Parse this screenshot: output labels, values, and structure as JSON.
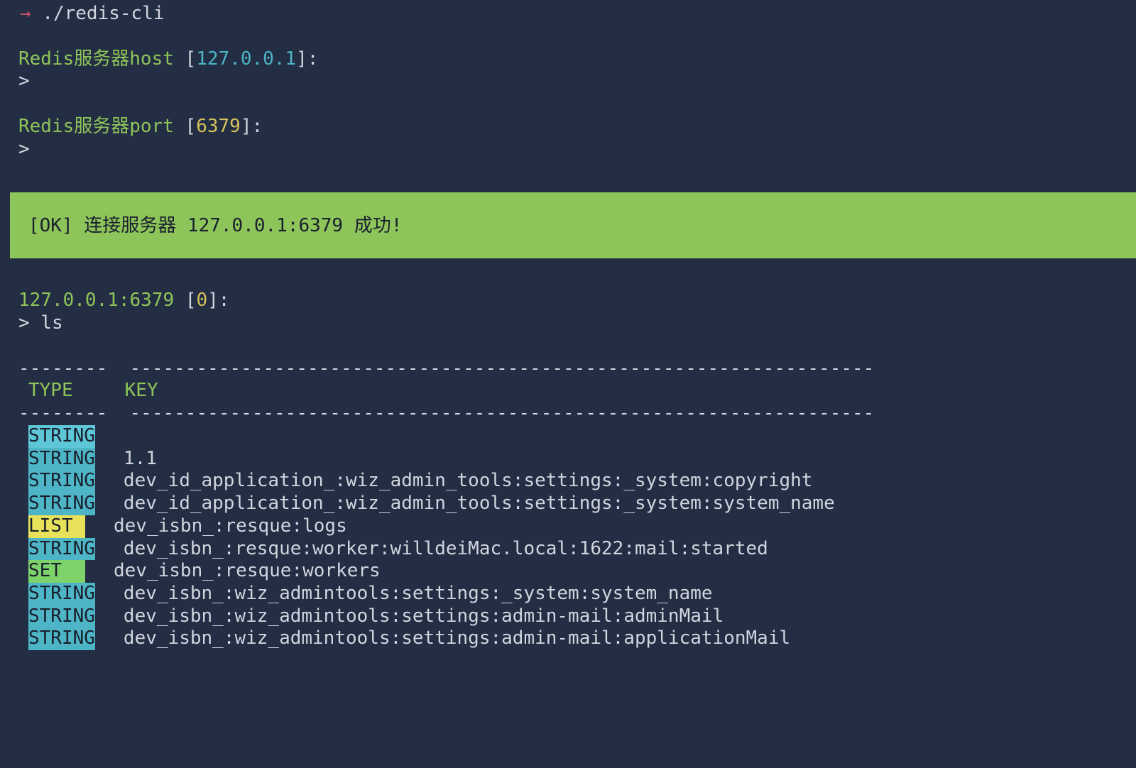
{
  "command": {
    "arrow": "→",
    "text": "./redis-cli"
  },
  "prompts": {
    "host_label": "Redis服务器host",
    "host_default": "127.0.0.1",
    "port_label": "Redis服务器port",
    "port_default": "6379",
    "gt": ">"
  },
  "ok_banner": "[OK] 连接服务器 127.0.0.1:6379 成功!",
  "connection": {
    "address": "127.0.0.1:6379",
    "db": "0",
    "command": "ls"
  },
  "table": {
    "divider_top": "--------  -------------------------------------------------------------------",
    "divider_mid": "--------  -------------------------------------------------------------------",
    "headers": {
      "type": "TYPE",
      "key": "KEY"
    },
    "rows": [
      {
        "type": "STRING",
        "typeClass": "type-string-hl",
        "key": ""
      },
      {
        "type": "STRING",
        "typeClass": "type-string",
        "key": "1.1"
      },
      {
        "type": "STRING",
        "typeClass": "type-string",
        "key": "dev_id_application_:wiz_admin_tools:settings:_system:copyright"
      },
      {
        "type": "STRING",
        "typeClass": "type-string",
        "key": "dev_id_application_:wiz_admin_tools:settings:_system:system_name"
      },
      {
        "type": "LIST",
        "typeClass": "type-list",
        "key": "dev_isbn_:resque:logs"
      },
      {
        "type": "STRING",
        "typeClass": "type-string",
        "key": "dev_isbn_:resque:worker:willdeiMac.local:1622:mail:started"
      },
      {
        "type": "SET",
        "typeClass": "type-set",
        "key": "dev_isbn_:resque:workers"
      },
      {
        "type": "STRING",
        "typeClass": "type-string",
        "key": "dev_isbn_:wiz_admintools:settings:_system:system_name"
      },
      {
        "type": "STRING",
        "typeClass": "type-string",
        "key": "dev_isbn_:wiz_admintools:settings:admin-mail:adminMail"
      },
      {
        "type": "STRING",
        "typeClass": "type-string",
        "key": "dev_isbn_:wiz_admintools:settings:admin-mail:applicationMail"
      }
    ]
  }
}
